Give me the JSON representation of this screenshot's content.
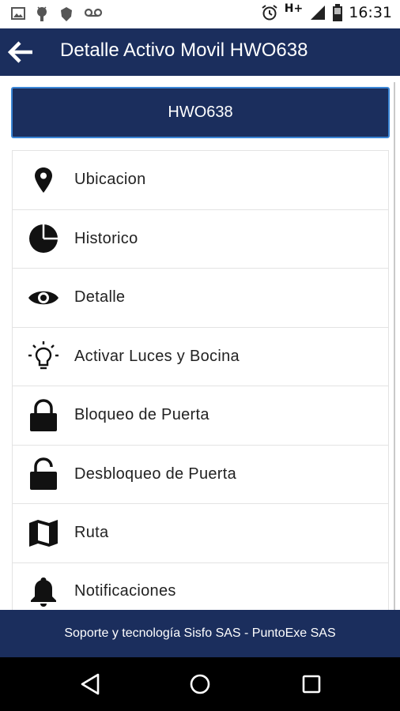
{
  "status_bar": {
    "time": "16:31",
    "network": "H+",
    "icons": [
      "image-icon",
      "android-icon",
      "shield-icon",
      "voicemail-icon",
      "alarm-icon",
      "signal-icon",
      "battery-icon"
    ]
  },
  "app_bar": {
    "title": "Detalle Activo Movil HWO638",
    "back_icon": "arrow-left-icon"
  },
  "plate": {
    "label": "HWO638"
  },
  "menu": {
    "items": [
      {
        "label": "Ubicacion",
        "icon": "location-pin-icon"
      },
      {
        "label": "Historico",
        "icon": "pie-chart-icon"
      },
      {
        "label": "Detalle",
        "icon": "eye-icon"
      },
      {
        "label": "Activar Luces y Bocina",
        "icon": "lightbulb-icon"
      },
      {
        "label": "Bloqueo de Puerta",
        "icon": "lock-icon"
      },
      {
        "label": "Desbloqueo de Puerta",
        "icon": "unlock-icon"
      },
      {
        "label": "Ruta",
        "icon": "map-icon"
      },
      {
        "label": "Notificaciones",
        "icon": "bell-icon"
      }
    ]
  },
  "footer": {
    "text": "Soporte y tecnología Sisfo SAS - PuntoExe SAS"
  },
  "nav_bar": {
    "icons": [
      "back-triangle-icon",
      "home-circle-icon",
      "recents-square-icon"
    ]
  },
  "colors": {
    "primary": "#1b2e5d",
    "plate_border": "#3b86d6",
    "divider": "#e3e3e3",
    "text": "#222222"
  }
}
